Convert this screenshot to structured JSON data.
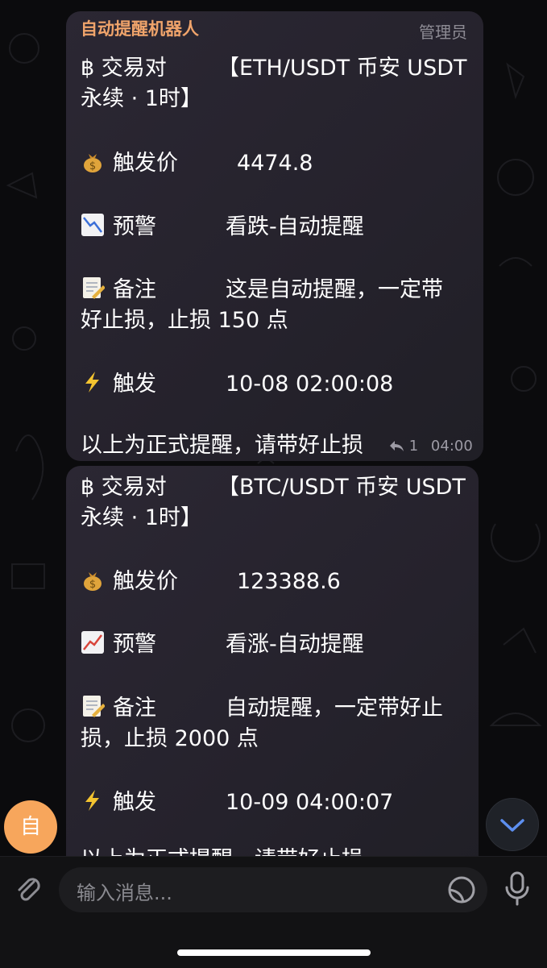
{
  "messages": [
    {
      "sender": "自动提醒机器人",
      "role": "管理员",
      "pair_label": "交易对",
      "pair_value_1": "【ETH/USDT 币安 USDT",
      "pair_value_2": "永续 · 1时】",
      "price_label": "触发价",
      "price_value": "4474.8",
      "alert_label": "预警",
      "alert_value": "看跌-自动提醒",
      "note_label": "备注",
      "note_value_1": "这是自动提醒，一定带",
      "note_value_2": "好止损，止损 150 点",
      "trigger_label": "触发",
      "trigger_value": "10-08 02:00:08",
      "footer": "以上为正式提醒，请带好止损",
      "reply_count": "1",
      "time": "04:00"
    },
    {
      "pair_label": "交易对",
      "pair_value_1": "【BTC/USDT 币安 USDT",
      "pair_value_2": "永续 · 1时】",
      "price_label": "触发价",
      "price_value": "123388.6",
      "alert_label": "预警",
      "alert_value": "看涨-自动提醒",
      "note_label": "备注",
      "note_value_1": "自动提醒，一定带好止",
      "note_value_2": "损，止损 2000 点",
      "trigger_label": "触发",
      "trigger_value": "10-09 04:00:07",
      "footer": "以上为正式提醒，请带好止损"
    }
  ],
  "bitcoin_symbol": "฿",
  "fab_avatar_letter": "自",
  "composer": {
    "placeholder": "输入消息..."
  },
  "icons": {
    "money_bag": "money-bag-icon",
    "chart_down": "chart-decreasing-icon",
    "chart_up": "chart-increasing-icon",
    "memo": "memo-icon",
    "lightning": "lightning-icon",
    "reply": "reply-icon",
    "scroll_down": "chevron-down-icon",
    "attach": "paperclip-icon",
    "sticker": "sticker-icon",
    "mic": "microphone-icon"
  },
  "colors": {
    "sender": "#f0a46b",
    "fab": "#f7a65c",
    "accent": "#5d8ff0"
  }
}
